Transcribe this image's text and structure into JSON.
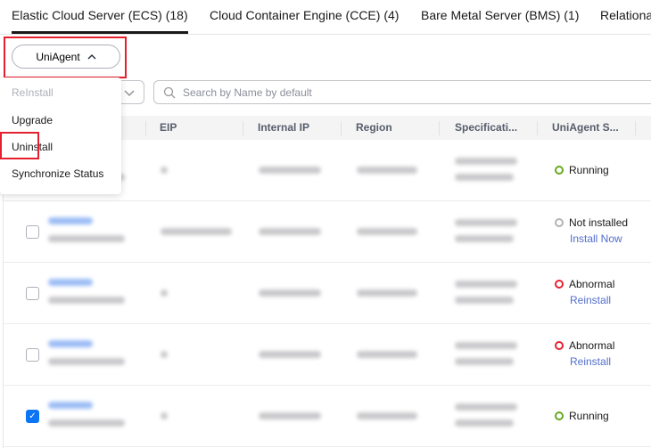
{
  "tabs": [
    {
      "label": "Elastic Cloud Server (ECS) (18)",
      "active": true
    },
    {
      "label": "Cloud Container Engine (CCE) (4)"
    },
    {
      "label": "Bare Metal Server (BMS) (1)"
    },
    {
      "label": "Relational"
    }
  ],
  "uniagent_button": {
    "label": "UniAgent",
    "icon": "chevron-up-icon"
  },
  "search": {
    "placeholder": "Search by Name by default"
  },
  "menu": {
    "items": [
      {
        "label": "ReInstall",
        "disabled": true
      },
      {
        "label": "Upgrade"
      },
      {
        "label": "Uninstall"
      },
      {
        "label": "Synchronize Status"
      }
    ]
  },
  "table": {
    "columns": [
      "EIP",
      "Internal IP",
      "Region",
      "Specificati...",
      "UniAgent S..."
    ],
    "rows": [
      {
        "checked": false,
        "status": "Running",
        "status_color": "#66a81f",
        "action": ""
      },
      {
        "checked": false,
        "status": "Not installed",
        "status_color": "#b3b3b3",
        "action": "Install Now"
      },
      {
        "checked": false,
        "status": "Abnormal",
        "status_color": "#e5202e",
        "action": "Reinstall"
      },
      {
        "checked": false,
        "status": "Abnormal",
        "status_color": "#e5202e",
        "action": "Reinstall"
      },
      {
        "checked": true,
        "status": "Running",
        "status_color": "#66a81f",
        "action": ""
      }
    ]
  }
}
